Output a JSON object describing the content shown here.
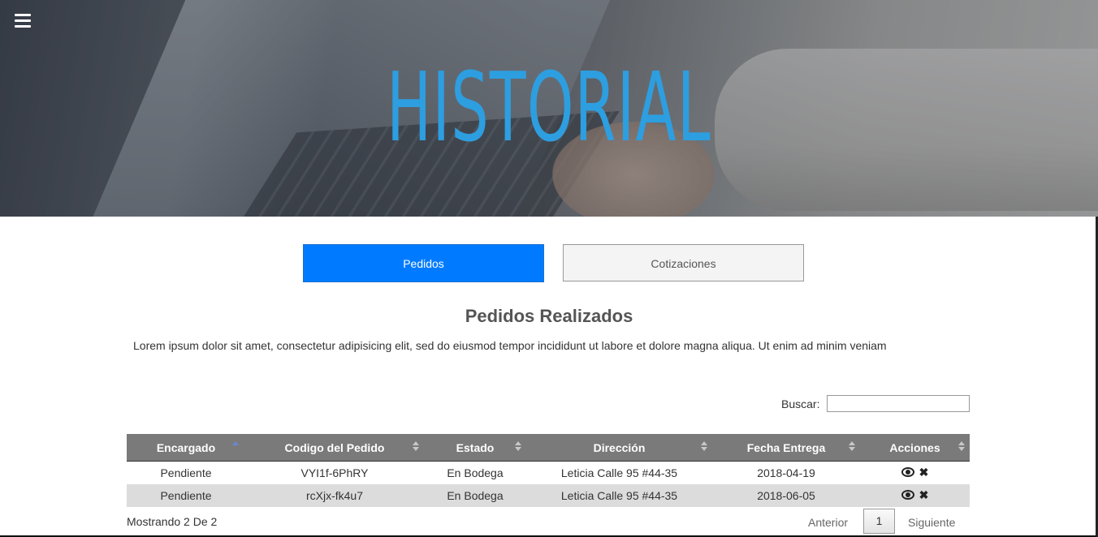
{
  "hero": {
    "title": "HISTORIAL"
  },
  "tabs": [
    {
      "label": "Pedidos",
      "active": true
    },
    {
      "label": "Cotizaciones",
      "active": false
    }
  ],
  "section": {
    "title": "Pedidos Realizados",
    "description": "Lorem ipsum dolor sit amet, consectetur adipisicing elit, sed do eiusmod tempor incididunt ut labore et dolore magna aliqua. Ut enim ad minim veniam"
  },
  "search": {
    "label": "Buscar:",
    "value": ""
  },
  "table": {
    "headers": [
      "Encargado",
      "Codigo del Pedido",
      "Estado",
      "Dirección",
      "Fecha Entrega",
      "Acciones"
    ],
    "rows": [
      [
        "Pendiente",
        "VYI1f-6PhRY",
        "En Bodega",
        "Leticia Calle 95 #44-35",
        "2018-04-19"
      ],
      [
        "Pendiente",
        "rcXjx-fk4u7",
        "En Bodega",
        "Leticia Calle 95 #44-35",
        "2018-06-05"
      ]
    ],
    "action_icons": [
      "eye-icon",
      "close-icon"
    ]
  },
  "pagination": {
    "info": "Mostrando 2 De 2",
    "prev_label": "Anterior",
    "page": "1",
    "next_label": "Siguiente"
  },
  "colors": {
    "accent": "#007bff",
    "hero_title": "#2d9ee0",
    "table_header": "#7a7a7a"
  }
}
